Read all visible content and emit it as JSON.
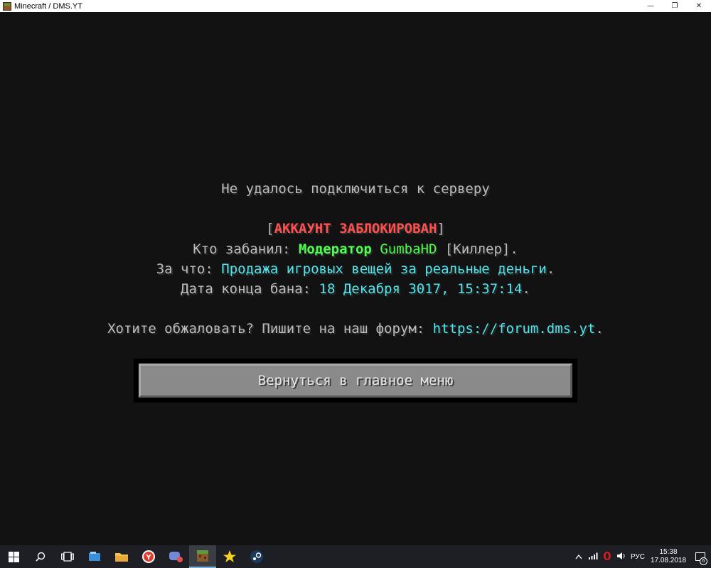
{
  "window": {
    "title": "Minecraft / DMS.YT",
    "minimize_glyph": "—",
    "restore_glyph": "❐",
    "close_glyph": "✕"
  },
  "screen": {
    "heading": "Не удалось подключиться к серверу",
    "status_open": "[",
    "status": "АККАУНТ ЗАБЛОКИРОВАН",
    "status_close": "]",
    "banned_by_label": "Кто забанил: ",
    "banned_by_role": "Модератор",
    "banned_by_name": "GumbaHD",
    "banned_by_suffix": " [Киллер].",
    "reason_label": "За что: ",
    "reason": "Продажа игровых вещей за реальные деньги",
    "reason_suffix": ".",
    "end_label": "Дата конца бана: ",
    "end_date": "18 Декабря 3017, 15:37:14",
    "end_suffix": ".",
    "appeal_text": "Хотите обжаловать? Пишите на наш форум: ",
    "appeal_link": "https://forum.dms.yt",
    "appeal_suffix": ".",
    "back_button": "Вернуться в главное меню"
  },
  "taskbar": {
    "tray": {
      "language": "РУС",
      "time": "15:38",
      "date": "17.08.2018",
      "notification_count": "6"
    }
  },
  "colors": {
    "status_red": "#ff4f4f",
    "moderator_green": "#4dff4d",
    "info_aqua": "#4fe6ee",
    "text_gray": "#bdbdbd",
    "background": "#121212"
  },
  "icons": [
    "windows-start-icon",
    "search-icon",
    "task-view-icon",
    "explorer-icon",
    "folder-icon",
    "yandex-browser-icon",
    "discord-icon",
    "minecraft-icon",
    "star-icon",
    "steam-icon",
    "chevron-up-icon",
    "network-icon",
    "opera-icon",
    "volume-icon",
    "notification-icon"
  ]
}
